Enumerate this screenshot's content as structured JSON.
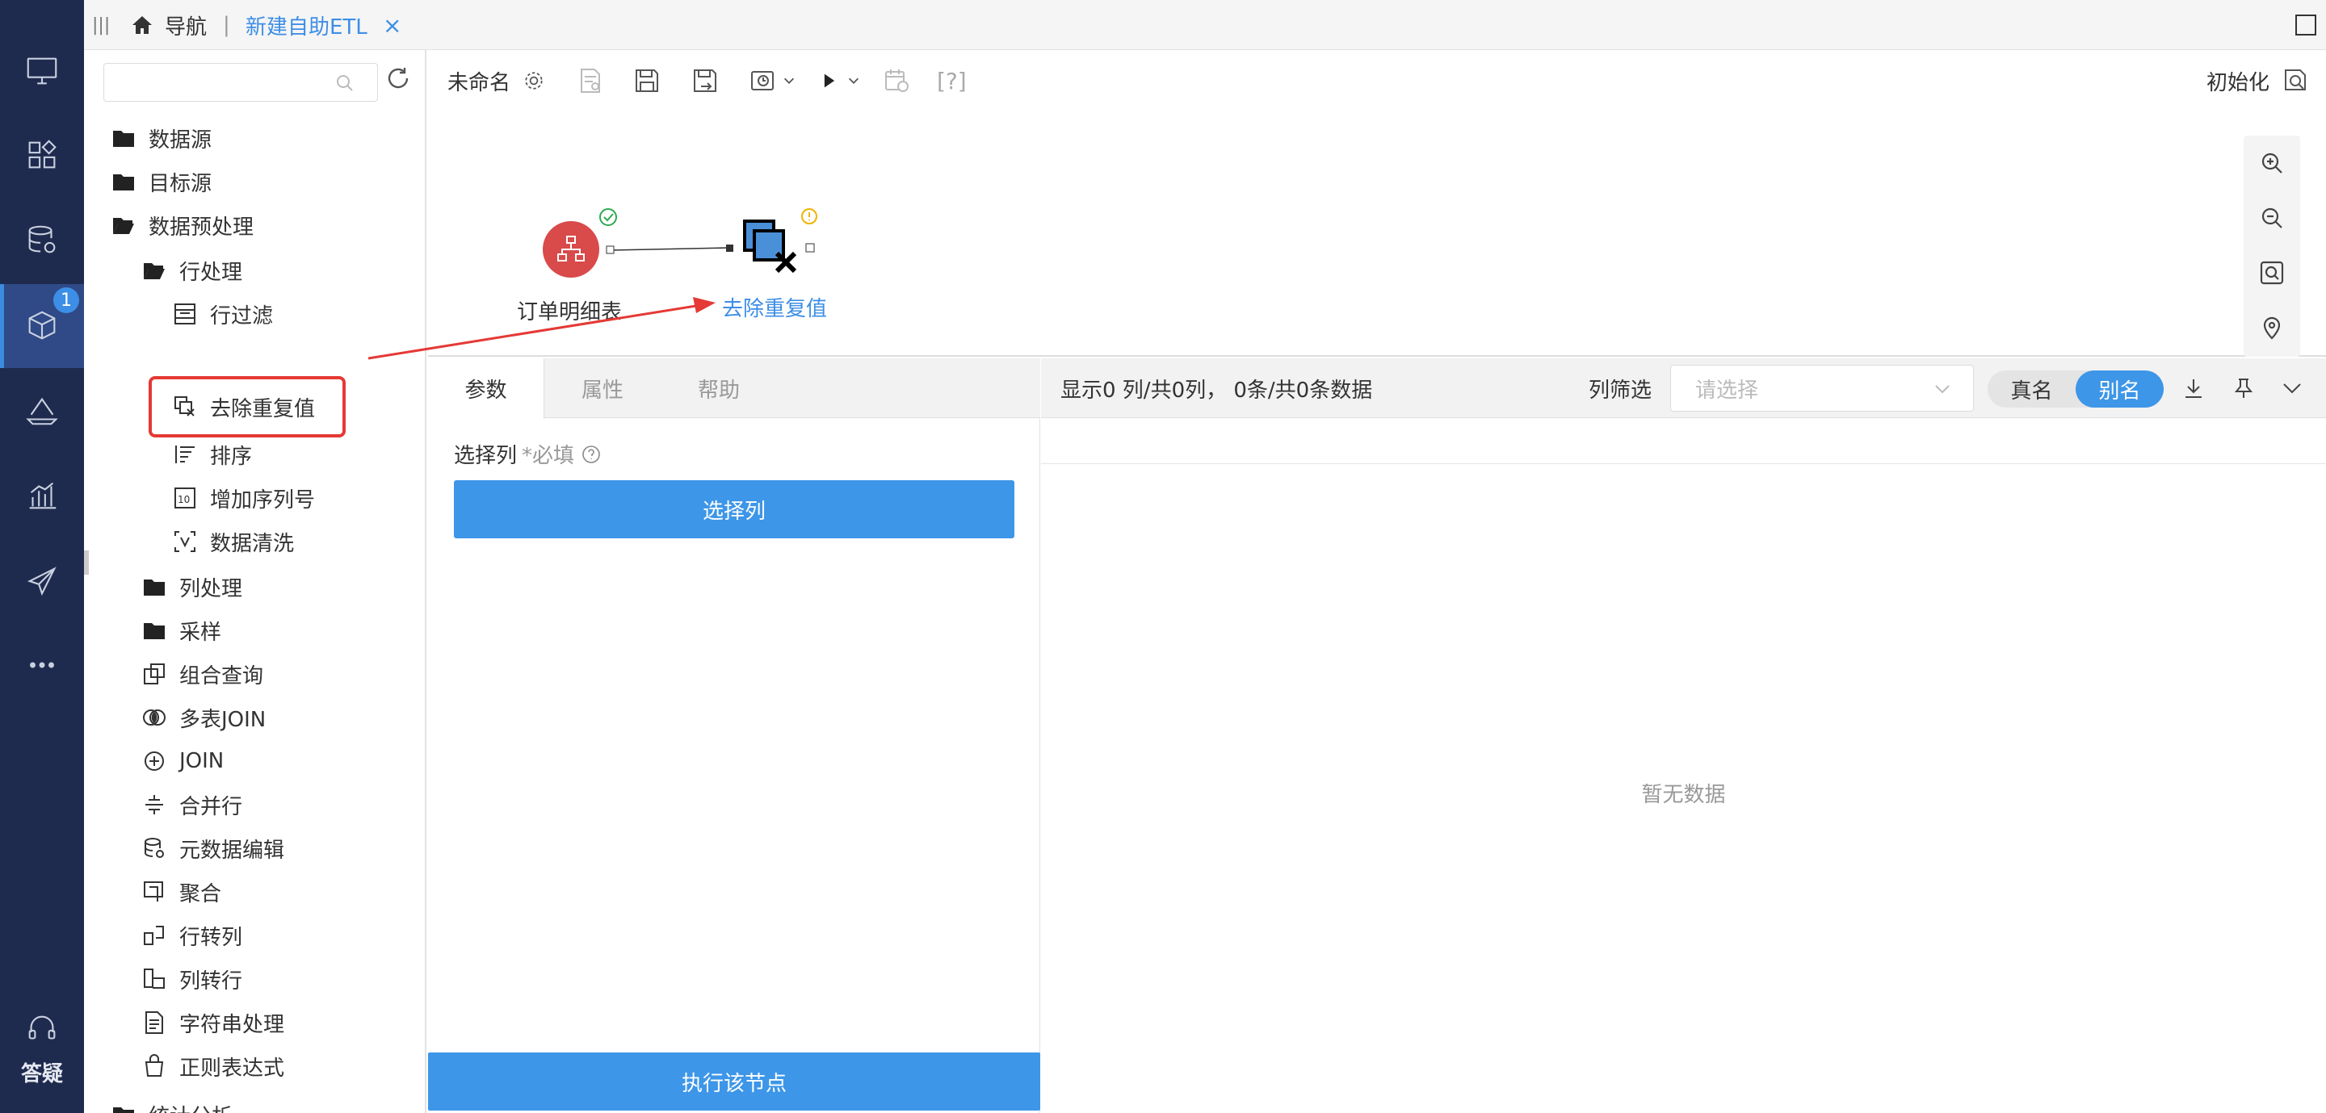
{
  "tabs": {
    "home_label": "导航",
    "active_label": "新建自助ETL"
  },
  "tree": {
    "search_placeholder": "",
    "items": [
      {
        "label": "数据源"
      },
      {
        "label": "目标源"
      },
      {
        "label": "数据预处理"
      },
      {
        "label": "行处理"
      },
      {
        "label": "行过滤"
      },
      {
        "label": "去除重复值"
      },
      {
        "label": "排序"
      },
      {
        "label": "增加序列号"
      },
      {
        "label": "数据清洗"
      },
      {
        "label": "列处理"
      },
      {
        "label": "采样"
      },
      {
        "label": "组合查询"
      },
      {
        "label": "多表JOIN"
      },
      {
        "label": "JOIN"
      },
      {
        "label": "合并行"
      },
      {
        "label": "元数据编辑"
      },
      {
        "label": "聚合"
      },
      {
        "label": "行转列"
      },
      {
        "label": "列转行"
      },
      {
        "label": "字符串处理"
      },
      {
        "label": "正则表达式"
      },
      {
        "label": "统计分析"
      }
    ]
  },
  "rail": {
    "badge": "1",
    "help_label": "答疑"
  },
  "toolbar": {
    "name": "未命名",
    "init_label": "初始化"
  },
  "canvas": {
    "source_node_label": "订单明细表",
    "target_node_label": "去除重复值"
  },
  "params": {
    "tabs": [
      "参数",
      "属性",
      "帮助"
    ],
    "select_col_label": "选择列",
    "required_label": "*必填",
    "select_col_button": "选择列",
    "exec_button": "执行该节点"
  },
  "preview": {
    "summary": "显示0 列/共0列， 0条/共0条数据",
    "filter_label": "列筛选",
    "filter_placeholder": "请选择",
    "toggle_real": "真名",
    "toggle_alias": "别名",
    "empty_text": "暂无数据"
  },
  "colors": {
    "rail_bg": "#1f2b4e",
    "accent": "#3d96e8",
    "highlight_red": "#e53935"
  }
}
